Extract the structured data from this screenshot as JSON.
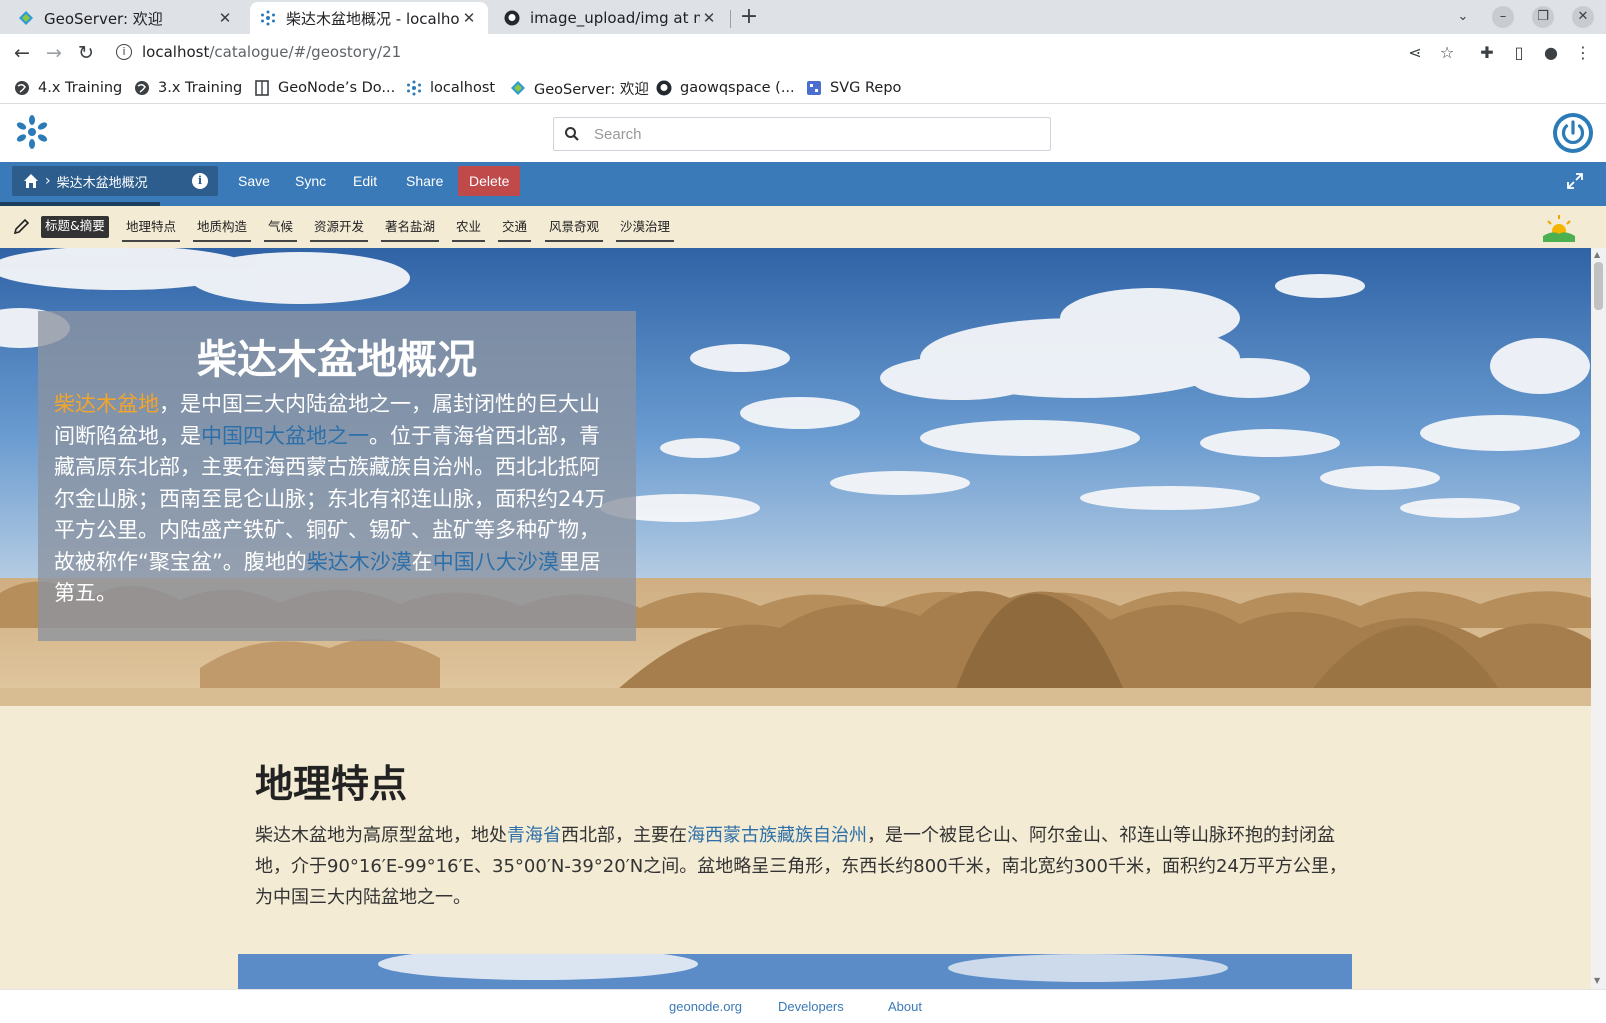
{
  "browser": {
    "tabs": [
      {
        "title": "GeoServer: 欢迎",
        "icon": "geoserver-icon"
      },
      {
        "title": "柴达木盆地概况 - localhost",
        "icon": "geonode-icon",
        "active": true
      },
      {
        "title": "image_upload/img at main",
        "icon": "github-icon"
      }
    ],
    "url_host": "localhost",
    "url_path": "/catalogue/#/geostory/21",
    "bookmarks": [
      {
        "label": "4.x Training",
        "icon": "globe-icon"
      },
      {
        "label": "3.x Training",
        "icon": "globe-icon"
      },
      {
        "label": "GeoNode’s Do...",
        "icon": "doc-icon"
      },
      {
        "label": "localhost",
        "icon": "geonode-icon"
      },
      {
        "label": "GeoServer: 欢迎",
        "icon": "geoserver-icon"
      },
      {
        "label": "gaowqspace (...",
        "icon": "github-icon"
      },
      {
        "label": "SVG Repo",
        "icon": "svgrepo-icon"
      }
    ]
  },
  "header": {
    "search_placeholder": "Search"
  },
  "storybar": {
    "title": "柴达木盆地概况",
    "buttons": [
      "Save",
      "Sync",
      "Edit",
      "Share",
      "Delete"
    ],
    "delete_color": "#c0494a",
    "bar_color": "#3a7ab8"
  },
  "sections_nav": [
    "标题&摘要",
    "地理特点",
    "地质构造",
    "气候",
    "资源开发",
    "著名盐湖",
    "农业",
    "交通",
    "风景奇观",
    "沙漠治理"
  ],
  "hero": {
    "title": "柴达木盆地概况",
    "p1_link": "柴达木盆地",
    "p1_a": "，是中国三大内陆盆地之一，属封闭性的巨大山间断陷盆地，是",
    "p1_link2": "中国四大盆地之一",
    "p1_b": "。位于青海省西北部，青藏高原东北部，主要在海西蒙古族藏族自治州。西北北抵阿尔金山脉；西南至昆仑山脉；东北有祁连山脉，面积约24万平方公里。内陆盛产铁矿、铜矿、锡矿、盐矿等多种矿物，故被称作“聚宝盆”。腹地的",
    "p1_link3": "柴达木沙漠",
    "p1_c": "在",
    "p1_link4": "中国八大沙漠",
    "p1_d": "里居第五。"
  },
  "section1": {
    "title": "地理特点",
    "t1": "柴达木盆地为高原型盆地，地处",
    "l1": "青海省",
    "t2": "西北部，主要在",
    "l2": "海西蒙古族藏族自治州",
    "t3": "，是一个被昆仑山、阿尔金山、祁连山等山脉环抱的封闭盆地，介于90°16′E-99°16′E、35°00′N-39°20′N之间。盆地略呈三角形，东西长约800千米，南北宽约300千米，面积约24万平方公里，为中国三大内陆盆地之一。"
  },
  "footer": [
    "geonode.org",
    "Developers",
    "About"
  ]
}
